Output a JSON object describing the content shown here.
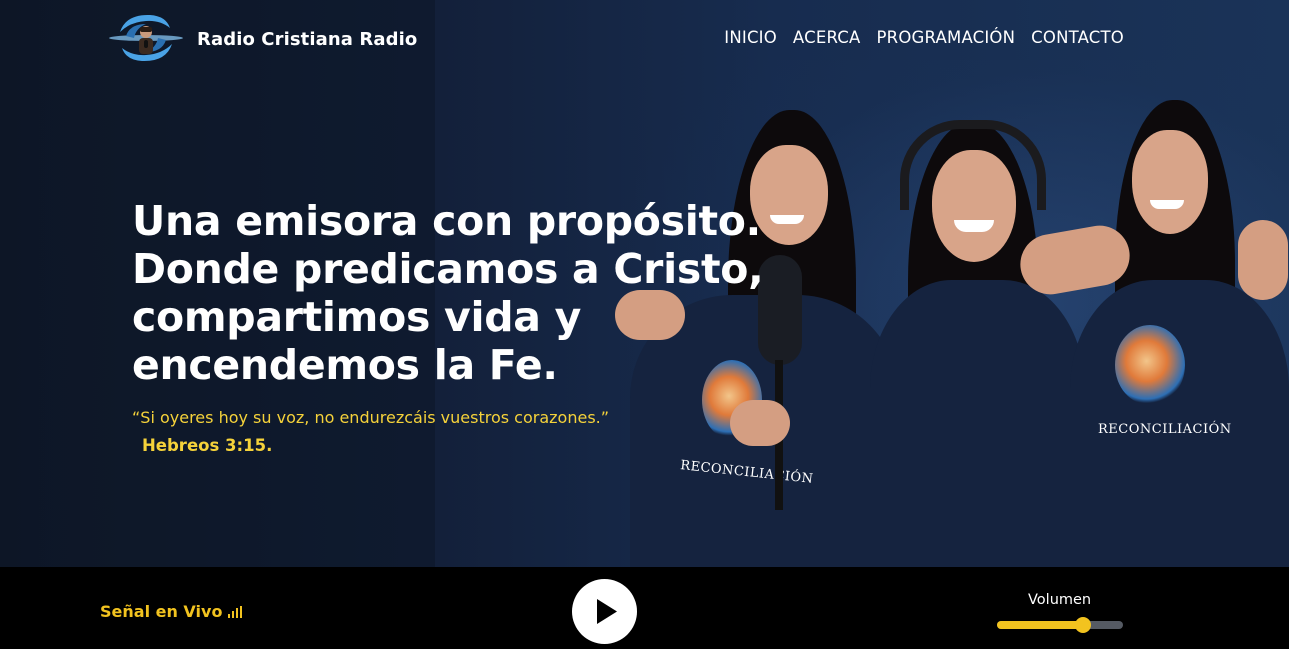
{
  "header": {
    "brand": "Radio Cristiana Radio",
    "logo_icon": "radio-host-logo",
    "nav": [
      {
        "label": "INICIO"
      },
      {
        "label": "ACERCA"
      },
      {
        "label": "PROGRAMACIÓN"
      },
      {
        "label": "CONTACTO"
      }
    ]
  },
  "hero": {
    "headline_lines": [
      "Una emisora con propósito.",
      "Donde predicamos a Cristo,",
      "compartimos vida y",
      "encendemos la Fe."
    ],
    "verse": "“Si oyeres hoy su voz, no endurezcáis vuestros corazones.”",
    "verse_ref": "Hebreos 3:15.",
    "photo": {
      "shirt_text_left": "RECONCILIACIÓN",
      "shirt_text_right": "RECONCILIACIÓN"
    }
  },
  "player": {
    "live_label": "Señal en Vivo",
    "signal_icon": "signal-bars-icon",
    "play_icon": "play-icon",
    "volume_label": "Volumen",
    "volume_level": 0.68
  },
  "colors": {
    "accent": "#f2c31f",
    "verse": "#f5d23a",
    "hero_bg": "#13203a",
    "player_bg": "#000000"
  }
}
